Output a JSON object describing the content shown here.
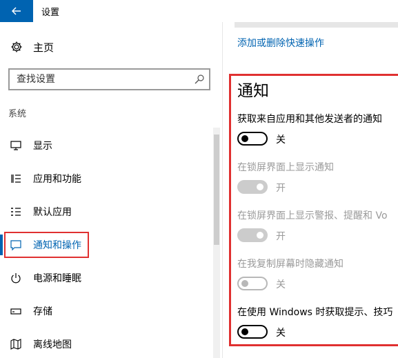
{
  "window": {
    "title": "设置"
  },
  "sidebar": {
    "home_label": "主页",
    "search_placeholder": "查找设置",
    "section_label": "系统",
    "items": [
      {
        "label": "显示",
        "icon": "monitor-icon"
      },
      {
        "label": "应用和功能",
        "icon": "apps-list-icon"
      },
      {
        "label": "默认应用",
        "icon": "default-apps-icon"
      },
      {
        "label": "通知和操作",
        "icon": "notification-icon",
        "active": true
      },
      {
        "label": "电源和睡眠",
        "icon": "power-icon"
      },
      {
        "label": "存储",
        "icon": "storage-icon"
      },
      {
        "label": "离线地图",
        "icon": "map-icon"
      }
    ]
  },
  "main": {
    "quick_actions_link": "添加或删除快速操作",
    "heading": "通知",
    "settings": [
      {
        "label": "获取来自应用和其他发送者的通知",
        "state": "关",
        "on": false,
        "disabled": false
      },
      {
        "label": "在锁屏界面上显示通知",
        "state": "开",
        "on": true,
        "disabled": true
      },
      {
        "label": "在锁屏界面上显示警报、提醒和 Vo",
        "state": "开",
        "on": true,
        "disabled": true
      },
      {
        "label": "在我复制屏幕时隐藏通知",
        "state": "关",
        "on": false,
        "disabled": true
      },
      {
        "label": "在使用 Windows 时获取提示、技巧",
        "state": "关",
        "on": false,
        "disabled": false
      }
    ]
  },
  "colors": {
    "accent": "#0063b1",
    "highlight": "#e03030"
  }
}
